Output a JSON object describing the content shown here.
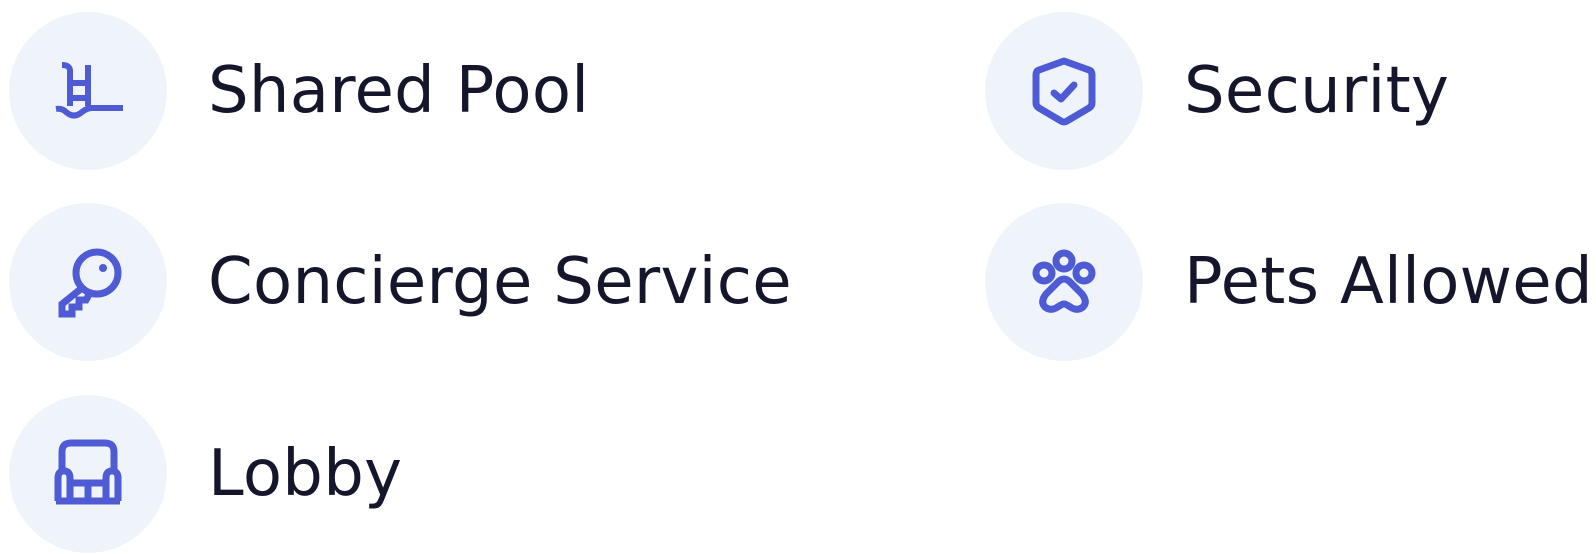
{
  "colors": {
    "icon": "#4f5bd5",
    "circle": "#eff4fb",
    "text": "#15162c"
  },
  "amenities": [
    {
      "label": "Shared Pool",
      "icon": "pool-icon"
    },
    {
      "label": "Security",
      "icon": "shield-check-icon"
    },
    {
      "label": "Concierge Service",
      "icon": "key-icon"
    },
    {
      "label": "Pets Allowed",
      "icon": "paw-icon"
    },
    {
      "label": "Lobby",
      "icon": "sofa-icon"
    }
  ]
}
